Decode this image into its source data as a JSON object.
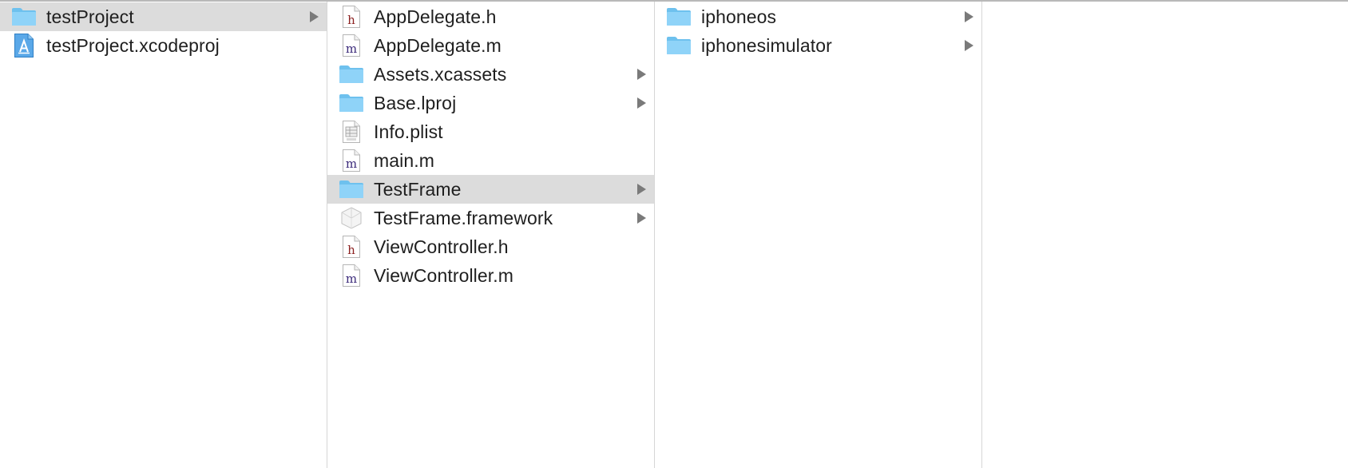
{
  "columns": [
    {
      "items": [
        {
          "label": "testProject",
          "icon": "folder-icon",
          "selected": true,
          "has_children": true
        },
        {
          "label": "testProject.xcodeproj",
          "icon": "xcodeproj-icon",
          "selected": false,
          "has_children": false
        }
      ]
    },
    {
      "items": [
        {
          "label": "AppDelegate.h",
          "icon": "header-file-icon",
          "letter": "h",
          "selected": false,
          "has_children": false
        },
        {
          "label": "AppDelegate.m",
          "icon": "objc-file-icon",
          "letter": "m",
          "selected": false,
          "has_children": false
        },
        {
          "label": "Assets.xcassets",
          "icon": "folder-icon",
          "selected": false,
          "has_children": true
        },
        {
          "label": "Base.lproj",
          "icon": "folder-icon",
          "selected": false,
          "has_children": true
        },
        {
          "label": "Info.plist",
          "icon": "plist-file-icon",
          "selected": false,
          "has_children": false
        },
        {
          "label": "main.m",
          "icon": "objc-file-icon",
          "letter": "m",
          "selected": false,
          "has_children": false
        },
        {
          "label": "TestFrame",
          "icon": "folder-icon",
          "selected": true,
          "has_children": true
        },
        {
          "label": "TestFrame.framework",
          "icon": "framework-icon",
          "selected": false,
          "has_children": true
        },
        {
          "label": "ViewController.h",
          "icon": "header-file-icon",
          "letter": "h",
          "selected": false,
          "has_children": false
        },
        {
          "label": "ViewController.m",
          "icon": "objc-file-icon",
          "letter": "m",
          "selected": false,
          "has_children": false
        }
      ]
    },
    {
      "items": [
        {
          "label": "iphoneos",
          "icon": "folder-icon",
          "selected": false,
          "has_children": true
        },
        {
          "label": "iphonesimulator",
          "icon": "folder-icon",
          "selected": false,
          "has_children": true
        }
      ]
    },
    {
      "items": []
    }
  ],
  "colors": {
    "selection": "#dcdcdc",
    "folder_body": "#8fd3f8",
    "folder_tab": "#6ec1ee",
    "header_letter": "#8b1f1f",
    "objc_letter": "#3b2a7a",
    "chevron": "#7a7a7a",
    "divider": "#d6d6d6"
  }
}
